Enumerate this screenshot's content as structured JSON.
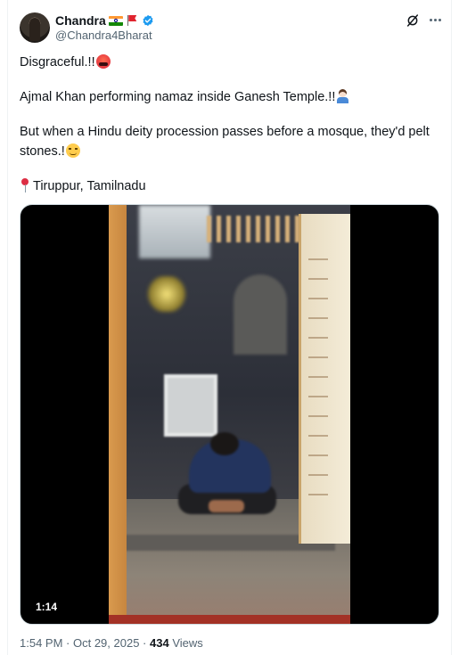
{
  "author": {
    "name": "Chandra",
    "handle": "@Chandra4Bharat",
    "flags": [
      "india-flag-icon",
      "red-flag-icon"
    ],
    "verified": true
  },
  "post": {
    "lines": [
      "Disgraceful.!!",
      "Ajmal Khan performing namaz inside Ganesh Temple.!!",
      "But when a Hindu deity procession passes before a mosque, they'd pelt",
      "stones.!",
      "Tiruppur, Tamilnadu"
    ]
  },
  "video": {
    "duration": "1:14"
  },
  "meta": {
    "time": "1:54 PM",
    "separator1": " · ",
    "date": "Oct 29, 2025",
    "separator2": " · ",
    "views_count": "434",
    "views_label": " Views"
  },
  "colors": {
    "text": "#0f1419",
    "secondary": "#536471",
    "verified": "#1d9bf0",
    "border": "#cfd9de"
  }
}
